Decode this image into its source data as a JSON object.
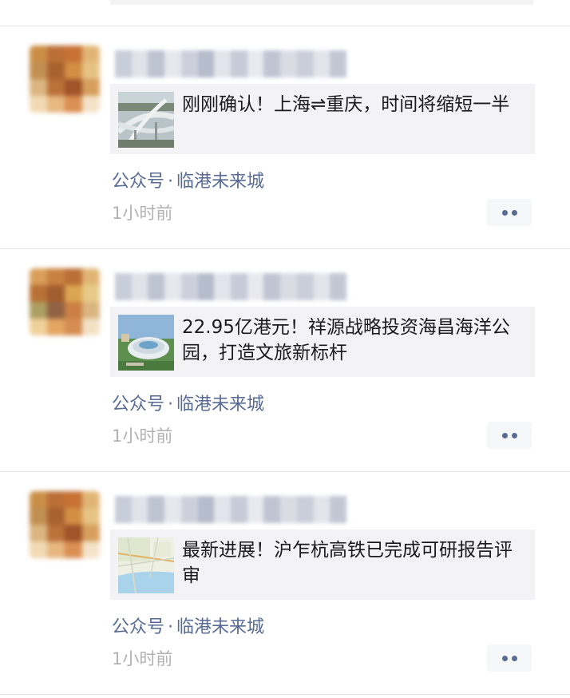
{
  "posts": [
    {
      "title": "刚刚确认！上海⇌重庆，时间将缩短一半",
      "source": "公众号",
      "separator": "·",
      "account": "临港未来城",
      "time": "1小时前",
      "thumb_icon": "highway-interchange-thumbnail"
    },
    {
      "title": "22.95亿港元！祥源战略投资海昌海洋公园，打造文旅新标杆",
      "source": "公众号",
      "separator": "·",
      "account": "临港未来城",
      "time": "1小时前",
      "thumb_icon": "ocean-park-thumbnail"
    },
    {
      "title": "最新进展！沪乍杭高铁已完成可研报告评审",
      "source": "公众号",
      "separator": "·",
      "account": "临港未来城",
      "time": "1小时前",
      "thumb_icon": "map-thumbnail"
    }
  ],
  "colors": {
    "link": "#576b95",
    "time": "#b2b2b2",
    "card_bg": "#f3f3f5"
  }
}
